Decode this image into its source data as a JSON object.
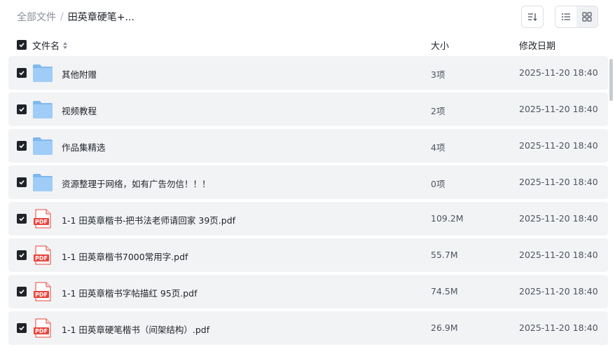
{
  "breadcrumb": {
    "root": "全部文件",
    "separator": "/",
    "current": "田英章硬笔+..."
  },
  "toolbar": {
    "sort_icon": "sort-icon",
    "list_view_icon": "list-view-icon",
    "grid_view_icon": "grid-view-icon",
    "active_view": "list"
  },
  "columns": {
    "name": "文件名",
    "size": "大小",
    "date": "修改日期"
  },
  "files": [
    {
      "type": "folder",
      "name": "其他附赠",
      "size": "3项",
      "date": "2025-11-20 18:40",
      "checked": true
    },
    {
      "type": "folder",
      "name": "视频教程",
      "size": "2项",
      "date": "2025-11-20 18:40",
      "checked": true
    },
    {
      "type": "folder",
      "name": "作品集精选",
      "size": "4项",
      "date": "2025-11-20 18:40",
      "checked": true
    },
    {
      "type": "folder",
      "name": "资源整理于网络，如有广告勿信！！！",
      "size": "0项",
      "date": "2025-11-20 18:40",
      "checked": true
    },
    {
      "type": "pdf",
      "name": "1-1 田英章楷书-把书法老师请回家 39页.pdf",
      "size": "109.2M",
      "date": "2025-11-20 18:40",
      "checked": true
    },
    {
      "type": "pdf",
      "name": "1-1 田英章楷书7000常用字.pdf",
      "size": "55.7M",
      "date": "2025-11-20 18:40",
      "checked": true
    },
    {
      "type": "pdf",
      "name": "1-1 田英章楷书字帖描红 95页.pdf",
      "size": "74.5M",
      "date": "2025-11-20 18:40",
      "checked": true
    },
    {
      "type": "pdf",
      "name": "1-1 田英章硬笔楷书（间架结构）.pdf",
      "size": "26.9M",
      "date": "2025-11-20 18:40",
      "checked": true
    }
  ],
  "pdf_label": "PDF",
  "colors": {
    "row_bg": "#f2f3f5",
    "folder": "#8fc4f5",
    "pdf_red": "#e8453c",
    "checkbox": "#1f2329"
  }
}
